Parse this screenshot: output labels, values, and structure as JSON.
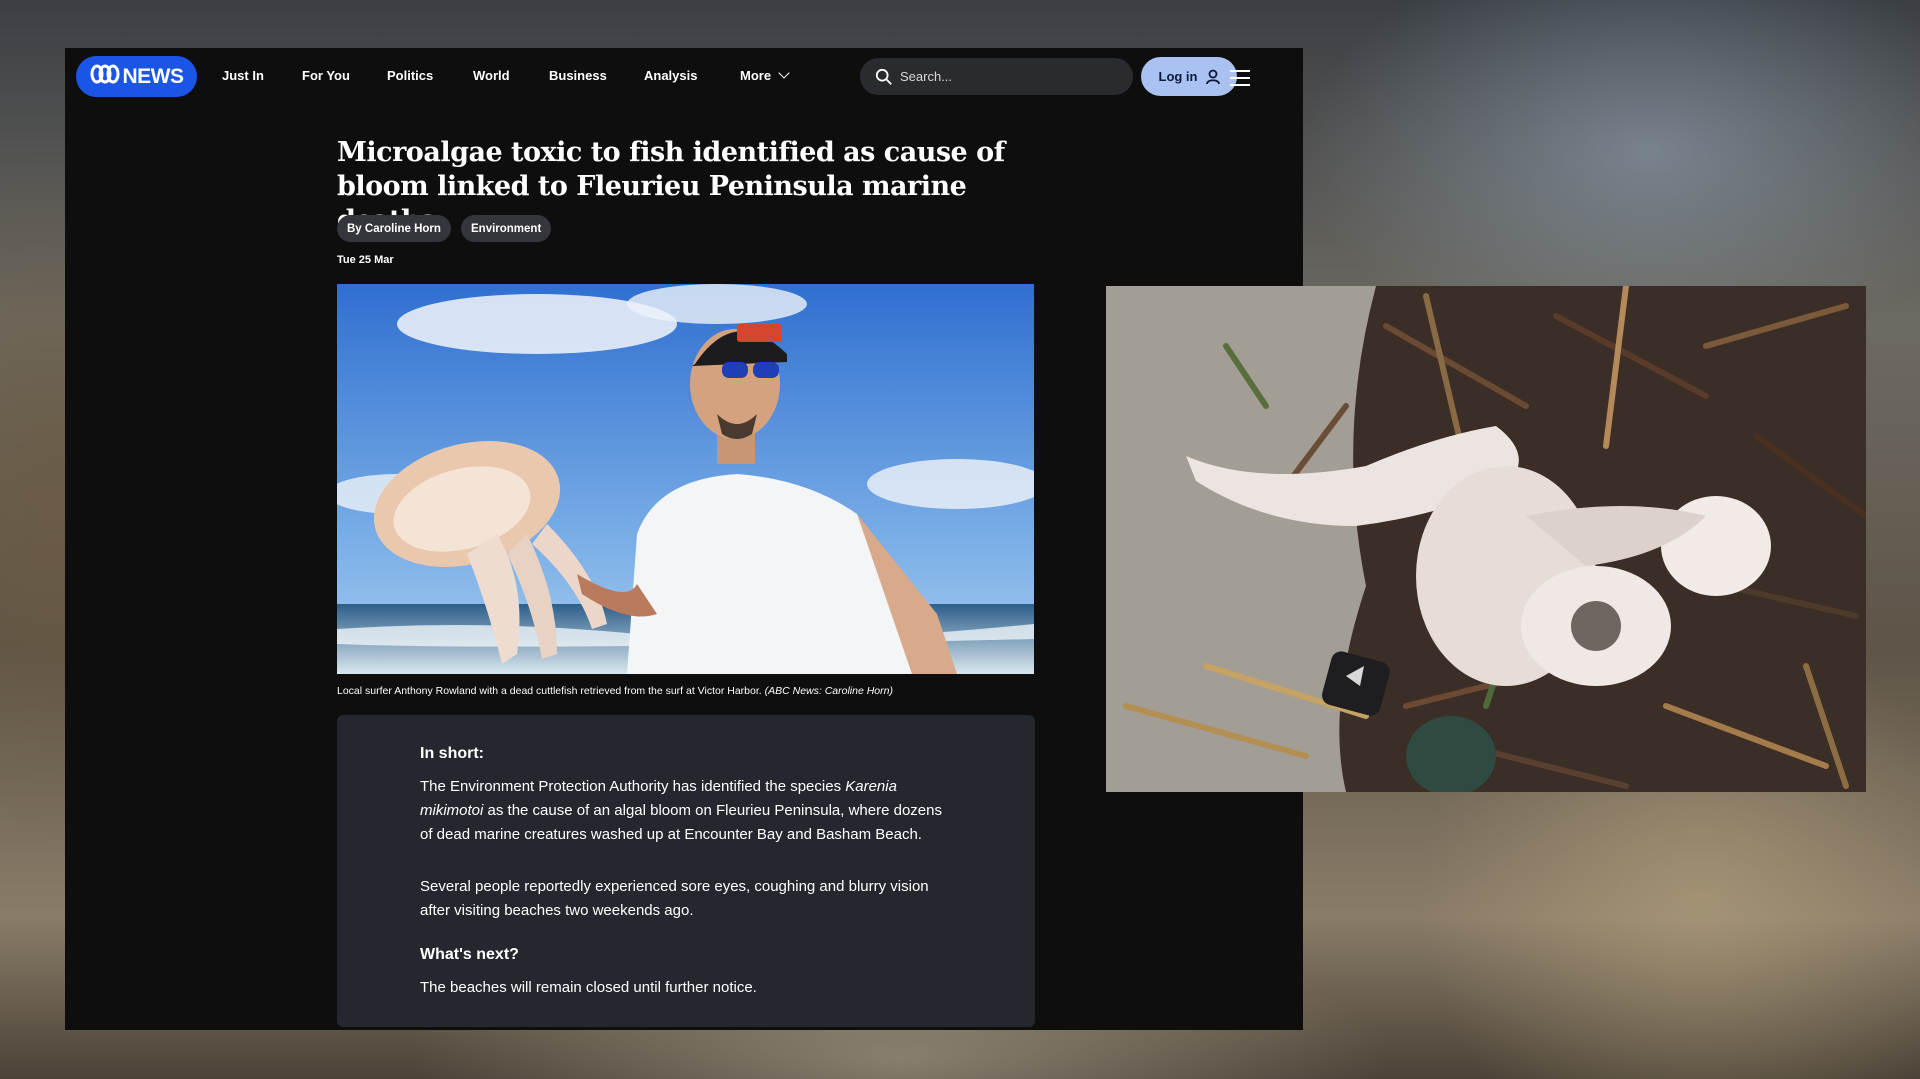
{
  "nav": {
    "logo_text": "NEWS",
    "links": [
      "Just In",
      "For You",
      "Politics",
      "World",
      "Business",
      "Analysis",
      "More"
    ],
    "search_placeholder": "Search...",
    "login_label": "Log in"
  },
  "article": {
    "headline": "Microalgae toxic to fish identified as cause of bloom linked to Fleurieu Peninsula marine deaths",
    "author_tag": "By Caroline Horn",
    "topic_tag": "Environment",
    "date": "Tue 25 Mar",
    "hero_caption": "Local surfer Anthony Rowland with a dead cuttlefish retrieved from the surf at Victor Harbor.",
    "hero_credit": "(ABC News: Caroline Horn)"
  },
  "in_short": {
    "heading": "In short:",
    "p1_before": "The Environment Protection Authority has identified the species",
    "p1_species": "Karenia mikimotoi",
    "p1_after": "as the cause of an algal bloom on Fleurieu Peninsula, where dozens of dead marine creatures washed up at Encounter Bay and Basham Beach.",
    "p2": "Several people reportedly experienced sore eyes, coughing and blurry vision after visiting beaches two weekends ago.",
    "next_heading": "What's next?",
    "next_text": "The beaches will remain closed until further notice."
  },
  "icons": {
    "search": "search-icon",
    "user": "user-icon",
    "menu": "hamburger-menu-icon",
    "more": "chevron-down-icon"
  },
  "colors": {
    "brand_blue": "#1b55e6",
    "login_bg": "#a9c2f2",
    "page_bg": "#0e0e0f",
    "panel_bg": "#24272e"
  }
}
